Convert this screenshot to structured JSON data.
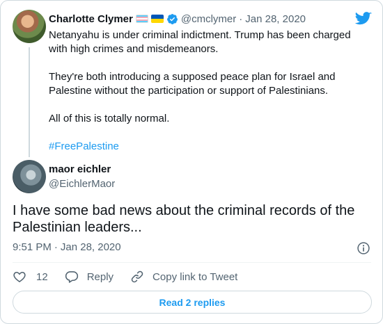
{
  "tweet": {
    "author_name": "Charlotte Clymer",
    "handle": "@cmclymer",
    "separator": "·",
    "date": "Jan 28, 2020",
    "paragraphs": [
      "Netanyahu is under criminal indictment. Trump has been charged with high crimes and misdemeanors.",
      "They're both introducing a supposed peace plan for Israel and Palestine without the participation or support of Palestinians.",
      "All of this is totally normal."
    ],
    "hashtag": "#FreePalestine",
    "flags": [
      "transgender-flag",
      "ukraine-flag"
    ],
    "verified": true
  },
  "reply": {
    "author_name": "maor eichler",
    "handle": "@EichlerMaor",
    "text": "I have some bad news about the criminal records of the Palestinian leaders...",
    "time": "9:51 PM",
    "separator": "·",
    "date": "Jan 28, 2020"
  },
  "actions": {
    "like_count": "12",
    "reply_label": "Reply",
    "copy_label": "Copy link to Tweet"
  },
  "read_replies_label": "Read 2 replies",
  "colors": {
    "accent": "#1d9bf0",
    "muted": "#536471",
    "border": "#cfd9de"
  },
  "icons": [
    "twitter-bird-icon",
    "verified-badge-icon",
    "info-icon",
    "heart-icon",
    "reply-icon",
    "link-icon"
  ]
}
